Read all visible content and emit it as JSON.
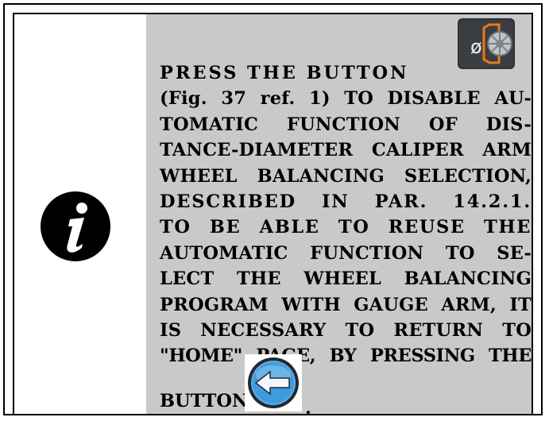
{
  "lines": [
    "PRESS THE BUTTON",
    "(Fig. 37 ref. 1) TO DISABLE AU-",
    "TOMATIC FUNCTION OF  DIS-",
    "TANCE-DIAMETER CALIPER ARM",
    "WHEEL BALANCING SELECTION,",
    "DESCRIBED IN PAR. 14.2.1.",
    "TO BE ABLE TO REUSE THE",
    "AUTOMATIC FUNCTION TO SE-",
    "LECT THE WHEEL BALANCING",
    "PROGRAM WITH GAUGE ARM, IT",
    "IS NECESSARY TO RETURN TO",
    "\"HOME\" PAGE, BY PRESSING THE"
  ],
  "final_label": "BUTTON",
  "final_dot": ".",
  "icons": {
    "info": "info-icon",
    "caliper_disable": "caliper-disable-button-icon",
    "back": "back-arrow-button-icon"
  },
  "colors": {
    "panel": "#c9c9c9",
    "caliper_bg": "#2f3236",
    "caliper_orange": "#e87a1a",
    "back_blue": "#3d9be0",
    "back_ring": "#1f2a36"
  }
}
